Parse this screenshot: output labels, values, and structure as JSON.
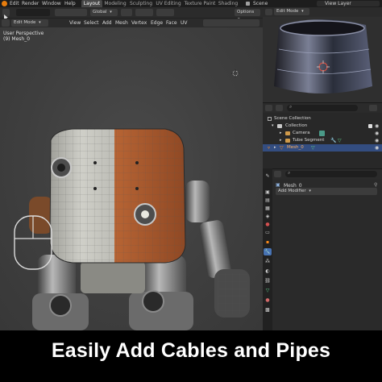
{
  "menubar": {
    "items": [
      "Edit",
      "Render",
      "Window",
      "Help"
    ],
    "workspaces": [
      "Layout",
      "Modeling",
      "Sculpting",
      "UV Editing",
      "Texture Paint",
      "Shading"
    ],
    "active_workspace": "Layout",
    "scene_name": "Scene",
    "view_layer": "View Layer"
  },
  "viewport_header": {
    "mode": "Edit Mode",
    "transform_orientation": "Global",
    "options_label": "Options",
    "menus": [
      "View",
      "Select",
      "Add",
      "Mesh",
      "Vertex",
      "Edge",
      "Face",
      "UV"
    ]
  },
  "viewport": {
    "view_name": "User Perspective",
    "object_label": "(9) Mesh_0"
  },
  "preview_header": {
    "mode": "Edit Mode"
  },
  "outliner": {
    "rows": [
      {
        "label": "Scene Collection"
      },
      {
        "label": "Collection"
      },
      {
        "label": "Camera"
      },
      {
        "label": "Tube Segment"
      },
      {
        "label": "Mesh_0"
      }
    ]
  },
  "properties": {
    "object_name": "Mesh_0",
    "add_modifier_label": "Add Modifier"
  },
  "banner": {
    "text": "Easily Add Cables and Pipes"
  },
  "colors": {
    "accent_blue": "#4772b3",
    "selection_orange": "#ff8c1a",
    "robot_orange": "#a9582c",
    "robot_white": "#c9c9c2"
  }
}
